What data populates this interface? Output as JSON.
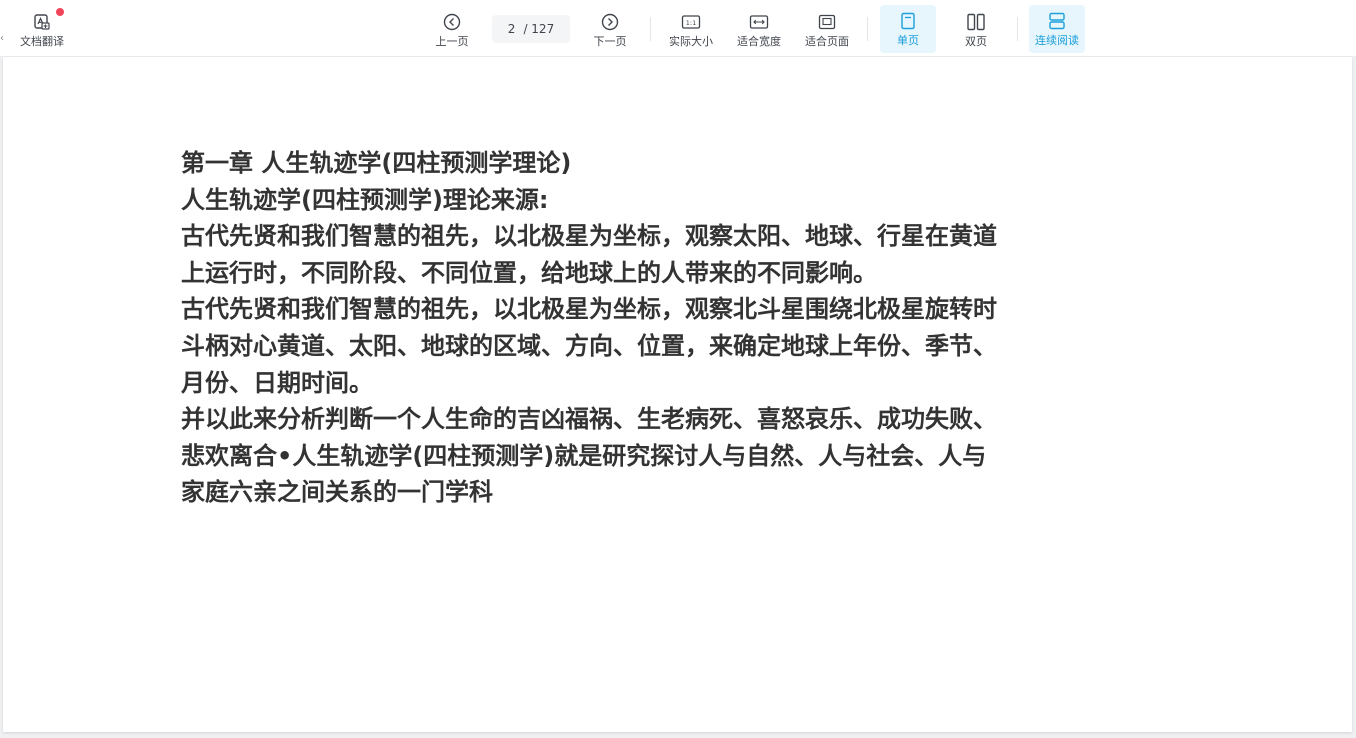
{
  "toolbar": {
    "translate_label": "文档翻译",
    "prev_label": "上一页",
    "current_page": "2",
    "total_pages": "/ 127",
    "next_label": "下一页",
    "actual_size_label": "实际大小",
    "fit_width_label": "适合宽度",
    "fit_page_label": "适合页面",
    "single_page_label": "单页",
    "double_page_label": "双页",
    "continuous_label": "连续阅读"
  },
  "colors": {
    "accent": "#1aa0dc",
    "accent_bg": "#e7f5fc",
    "badge": "#f0445a",
    "text": "#333333"
  },
  "icons": {
    "translate": "translate-doc-icon",
    "prev": "chevron-left-circle-icon",
    "next": "chevron-right-circle-icon",
    "actual_size": "one-to-one-icon",
    "fit_width": "fit-width-icon",
    "fit_page": "fit-page-icon",
    "single_page": "single-page-icon",
    "double_page": "double-page-icon",
    "continuous": "continuous-read-icon"
  },
  "document": {
    "lines": [
      "第一章 人生轨迹学(四柱预测学理论)",
      "人生轨迹学(四柱预测学)理论来源:",
      "古代先贤和我们智慧的祖先，以北极星为坐标，观察太阳、地球、行星在黄道",
      "上运行时，不同阶段、不同位置，给地球上的人带来的不同影响。",
      "古代先贤和我们智慧的祖先，以北极星为坐标，观察北斗星围绕北极星旋转时",
      "斗柄对心黄道、太阳、地球的区域、方向、位置，来确定地球上年份、季节、",
      "月份、日期时间。",
      "并以此来分析判断一个人生命的吉凶福祸、生老病死、喜怒哀乐、成功失败、",
      "悲欢离合•人生轨迹学(四柱预测学)就是研究探讨人与自然、人与社会、人与",
      "家庭六亲之间关系的一门学科"
    ]
  }
}
